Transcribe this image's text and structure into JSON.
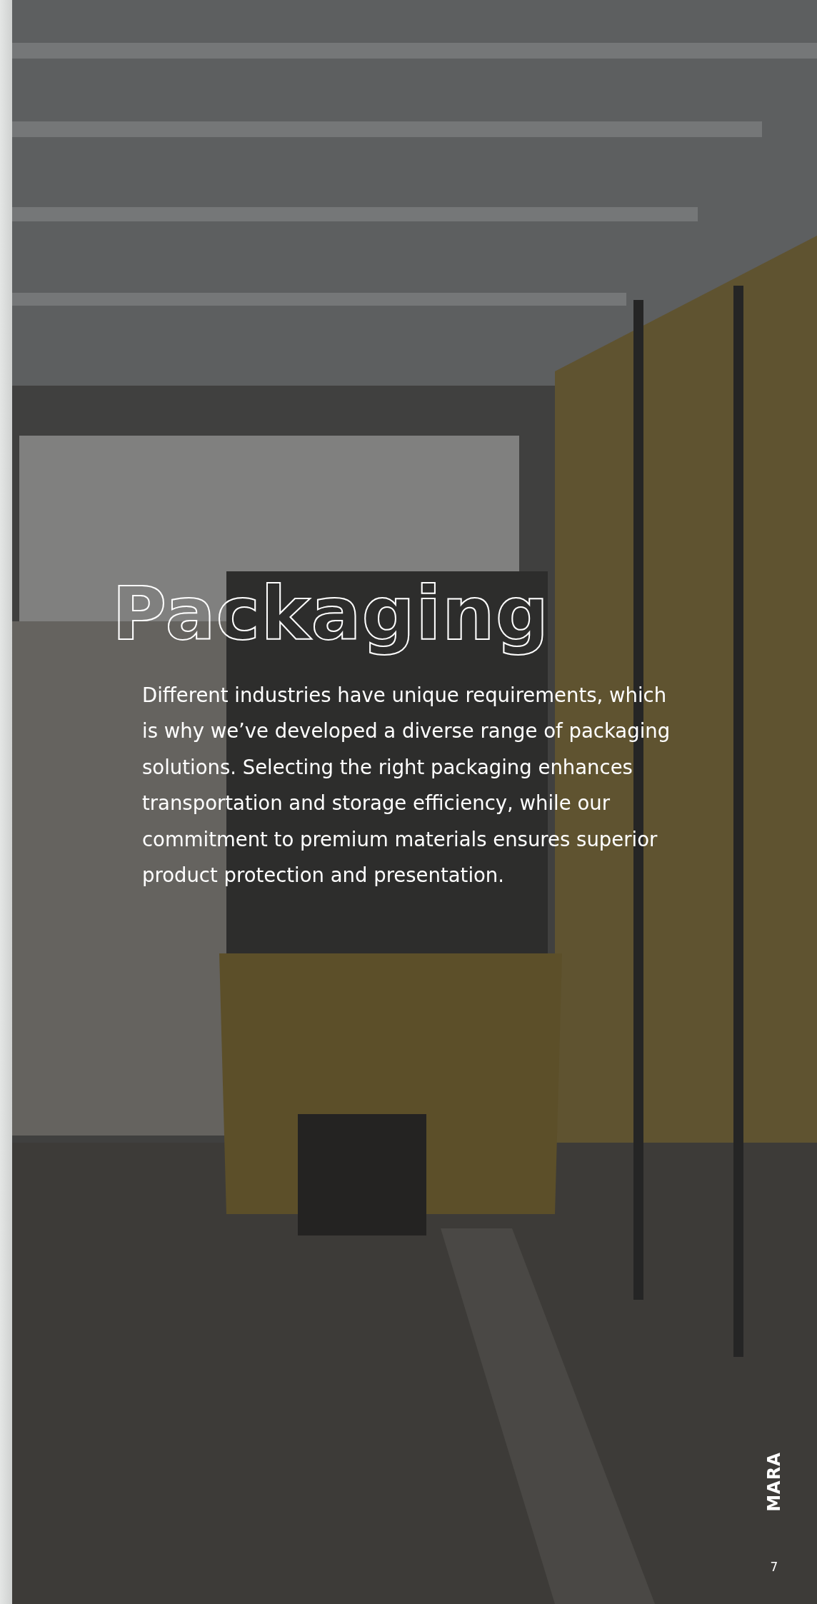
{
  "page": {
    "title": "Packaging",
    "body": "Different industries have unique requirements, which is why we’ve developed a diverse range of packaging solutions. Selecting the right packaging enhances transportation and storage efficiency, while our commitment to premium materials ensures superior product protection and presentation.",
    "logo": "MARA",
    "page_number": "7"
  }
}
